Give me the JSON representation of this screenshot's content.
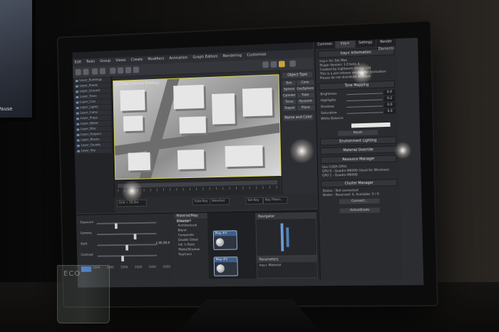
{
  "left_monitor": {
    "label": "Pause"
  },
  "app": {
    "menu": [
      "Edit",
      "Tools",
      "Group",
      "Views",
      "Create",
      "Modifiers",
      "Animation",
      "Graph Editors",
      "Rendering",
      "Customize"
    ],
    "viewport_label": "[+] [Top] [Default Shading]",
    "status_fields": [
      "Grid = 10,0m",
      "Auto Key",
      "Selected",
      "Set Key",
      "Key Filters..."
    ]
  },
  "command_panel": {
    "header": "Object Type",
    "buttons": [
      "Box",
      "Cone",
      "Sphere",
      "GeoSphere",
      "Cylinder",
      "Tube",
      "Torus",
      "Pyramid",
      "Teapot",
      "Plane"
    ],
    "name_header": "Name and Color"
  },
  "scene_explorer": {
    "rows": [
      "Layer_Buildings",
      "Layer_Roads",
      "Layer_Ground",
      "Layer_Trees",
      "Layer_Cars",
      "Layer_Lights",
      "Layer_Cams",
      "Layer_Props",
      "Layer_Water",
      "Layer_Misc",
      "Layer_Helpers",
      "Layer_Blocks",
      "Layer_Facade",
      "Layer_Sky"
    ]
  },
  "lower_left": {
    "sliders": [
      {
        "label": "Exposure",
        "value": ""
      },
      {
        "label": "Gamma",
        "value": ""
      },
      {
        "label": "Shift",
        "value": "1,0E,00,0"
      },
      {
        "label": "Contrast",
        "value": ""
      }
    ],
    "scale": [
      "1000",
      "2000",
      "1000",
      "1000",
      "1000",
      "1000"
    ]
  },
  "slate": {
    "browser_title": "Material/Map Browser",
    "browser_items": [
      "Standard",
      "Architectural",
      "Blend",
      "Composite",
      "Double Sided",
      "Ink 'n Paint",
      "Matte/Shadow",
      "Raytrace"
    ],
    "node_title_1": "Map #4",
    "node_title_2": "Map #5",
    "navigator_title": "Navigator",
    "params_title": "Parameters",
    "params_value": "Iray+ Material"
  },
  "right_panel": {
    "tabs": [
      "Common",
      "Iray+",
      "Settings",
      "Render Elements"
    ],
    "info_header": "Iray+ Information",
    "info_lines": [
      "Iray+ for 3ds Max",
      "Plugin Version: 1.0 beta 4",
      "Created by Lightwork Design Ltd",
      "",
      "This is a pre-release version for evaluation",
      "Please do not distribute or share"
    ],
    "tone_header": "Tone Mapping",
    "tone_rows": [
      {
        "label": "Brightness",
        "value": "0.0"
      },
      {
        "label": "Highlights",
        "value": "0.2"
      },
      {
        "label": "Shadows",
        "value": "0.0"
      },
      {
        "label": "Saturation",
        "value": "0.0"
      }
    ],
    "white_balance": "White Balance",
    "reset": "Reset",
    "env_header": "Environment Lighting",
    "material_header": "Material Override",
    "resource_header": "Resource Manager",
    "resource_lines": [
      "Use CUDA GPUs",
      "GPU 0 - Quadro M6000 (Used for Windows)",
      "GPU 1 - Quadro M6000"
    ],
    "cluster_header": "Cluster Manager",
    "cluster_lines": [
      "Status : Not connected",
      "Nodes : Reserved: 0, Available: 0 / 0"
    ],
    "connect": "Connect...",
    "render_button": "ActiveShade"
  },
  "glass": {
    "label": "ECO"
  }
}
